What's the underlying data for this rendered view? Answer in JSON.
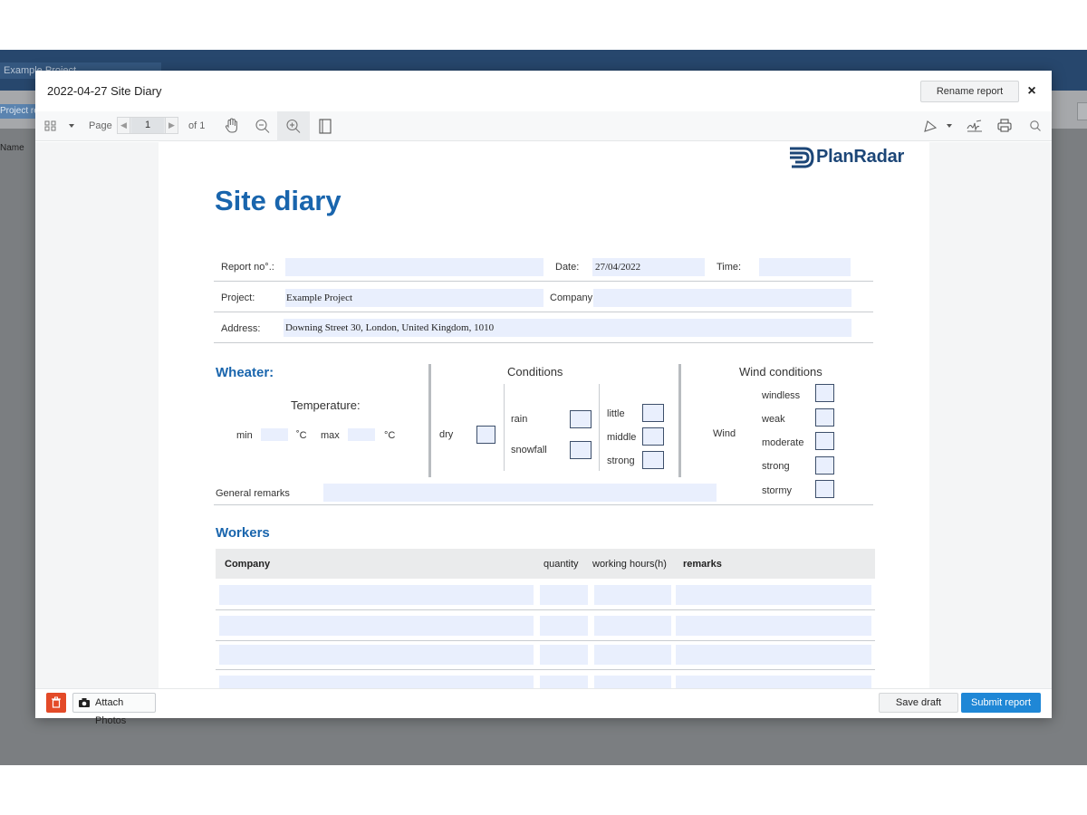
{
  "background": {
    "project_name": "Example Project",
    "tab_label": "Project reports",
    "column_header": "Name"
  },
  "modal": {
    "title": "2022-04-27 Site Diary",
    "rename_label": "Rename report",
    "close_label": "×"
  },
  "toolbar": {
    "page_label": "Page",
    "page_current": "1",
    "page_of": "of 1",
    "icons": [
      "grid-icon",
      "chevron-down-icon",
      "hand-tool-icon",
      "zoom-out-icon",
      "zoom-in-icon",
      "single-page-icon",
      "draw-icon",
      "chevron-down-icon",
      "signature-icon",
      "print-icon",
      "search-icon"
    ]
  },
  "document": {
    "brand": "PlanRadar",
    "title": "Site diary",
    "labels": {
      "report_no": "Report no°.:",
      "date": "Date:",
      "time": "Time:",
      "project": "Project:",
      "company": "Company:",
      "address": "Address:"
    },
    "values": {
      "date": "27/04/2022",
      "project": "Example Project",
      "address": "Downing Street 30, London, United Kingdom, 1010"
    },
    "weather": {
      "heading": "Wheater:",
      "temperature_label": "Temperature:",
      "min_label": "min",
      "max_label": "max",
      "unit1": "˚C",
      "unit2": "°C",
      "conditions_heading": "Conditions",
      "dry": "dry",
      "rain": "rain",
      "snowfall": "snowfall",
      "little": "little",
      "middle": "middle",
      "strong": "strong",
      "wind_heading": "Wind conditions",
      "wind_label": "Wind",
      "wind_options": [
        "windless",
        "weak",
        "moderate",
        "strong",
        "stormy"
      ],
      "general_remarks": "General remarks"
    },
    "workers": {
      "heading": "Workers",
      "columns": [
        "Company",
        "quantity",
        "working hours(h)",
        "remarks"
      ]
    }
  },
  "footer": {
    "attach_label": "Attach Photos",
    "save_label": "Save draft",
    "submit_label": "Submit report"
  },
  "colors": {
    "accent": "#1965ad",
    "primary_button": "#1f87d6",
    "delete_button": "#e34a28",
    "app_header": "#27476d"
  }
}
